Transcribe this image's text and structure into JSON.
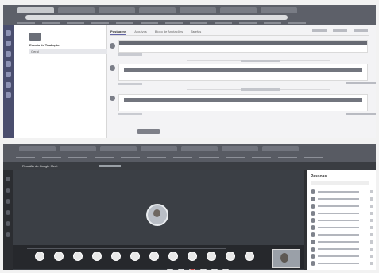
{
  "colors": {
    "teams_purple": "#6264a7",
    "meet_stage": "#3b3f45",
    "end_call_red": "#c04a4a"
  },
  "top_screenshot": {
    "nav": {
      "team_name": "Escola de Tradução",
      "channel": "Geral"
    },
    "channel_tabs": [
      "Postagens",
      "Arquivos",
      "Bloco de Anotações",
      "Tarefas"
    ],
    "active_tab": 0,
    "posts_visible": 3
  },
  "bottom_screenshot": {
    "meeting_title": "Reunião do Google Meet",
    "people_panel_title": "Pessoas",
    "participants_visible": 11,
    "playback_progress": 0,
    "controls": [
      "mic-icon",
      "camera-icon",
      "end-call-icon",
      "captions-icon",
      "present-icon",
      "more-icon"
    ],
    "bottom_buttons": [
      "back-icon",
      "play-icon",
      "forward-icon",
      "volume-icon",
      "settings-icon",
      "captions-icon",
      "fullscreen-icon",
      "share-icon",
      "chat-icon",
      "people-icon",
      "cast-icon",
      "more-icon"
    ]
  }
}
